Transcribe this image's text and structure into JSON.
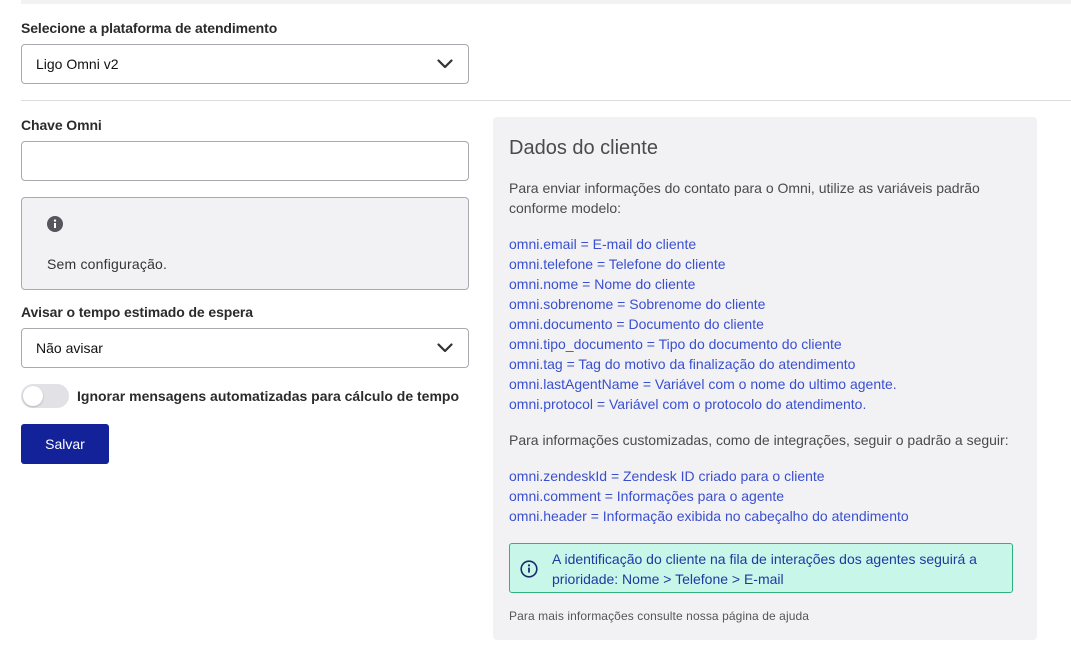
{
  "platform": {
    "label": "Selecione a plataforma de atendimento",
    "selected": "Ligo Omni v2"
  },
  "omni_key": {
    "label": "Chave Omni",
    "value": "",
    "placeholder": ""
  },
  "config_notice": {
    "icon": "info-icon",
    "text": "Sem configuração."
  },
  "wait_time": {
    "label": "Avisar o tempo estimado de espera",
    "selected": "Não avisar"
  },
  "ignore_toggle": {
    "label": "Ignorar mensagens automatizadas para cálculo de tempo",
    "on": false
  },
  "save_label": "Salvar",
  "client_panel": {
    "title": "Dados do cliente",
    "intro": "Para enviar informações do contato para o Omni, utilize as variáveis padrão conforme modelo:",
    "variables": [
      "omni.email = E-mail do cliente",
      "omni.telefone = Telefone do cliente",
      "omni.nome = Nome do cliente",
      "omni.sobrenome = Sobrenome do cliente",
      "omni.documento = Documento do cliente",
      "omni.tipo_documento = Tipo do documento do cliente",
      "omni.tag = Tag do motivo da finalização do atendimento",
      "omni.lastAgentName = Variável com o nome do ultimo agente.",
      "omni.protocol = Variável com o protocolo do atendimento."
    ],
    "custom_intro": "Para informações customizadas, como de integrações, seguir o padrão a seguir:",
    "custom_variables": [
      "omni.zendeskId = Zendesk ID criado para o cliente",
      "omni.comment = Informações para o agente",
      "omni.header = Informação exibida no cabeçalho do atendimento"
    ],
    "notice": "A identificação do cliente na fila de interações dos agentes seguirá a prioridade: Nome > Telefone > E-mail",
    "help": "Para mais informações consulte nossa página de ajuda"
  },
  "colors": {
    "primary": "#14229a",
    "link": "#3a4fd0",
    "panel_bg": "#f2f2f4",
    "notice_bg": "#c8f7ea",
    "notice_border": "#2fb37e"
  }
}
